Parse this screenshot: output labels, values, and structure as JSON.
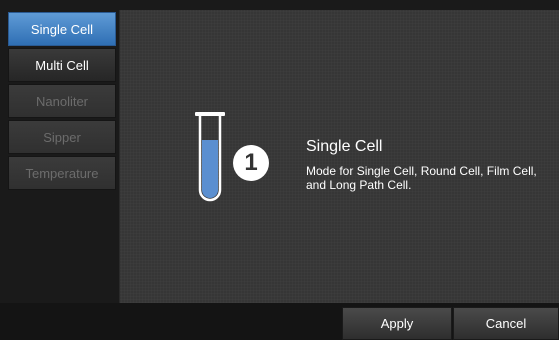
{
  "sidebar": {
    "items": [
      {
        "label": "Single Cell",
        "state": "active"
      },
      {
        "label": "Multi Cell",
        "state": "enabled"
      },
      {
        "label": "Nanoliter",
        "state": "disabled"
      },
      {
        "label": "Sipper",
        "state": "disabled"
      },
      {
        "label": "Temperature",
        "state": "disabled"
      }
    ]
  },
  "main": {
    "icon": "test-tube-icon",
    "step_number": "1",
    "title": "Single Cell",
    "description": "Mode for Single Cell, Round Cell, Film Cell, and Long Path Cell."
  },
  "footer": {
    "apply_label": "Apply",
    "cancel_label": "Cancel"
  },
  "colors": {
    "accent": "#4a8bd0",
    "liquid": "#5b8fd0"
  }
}
